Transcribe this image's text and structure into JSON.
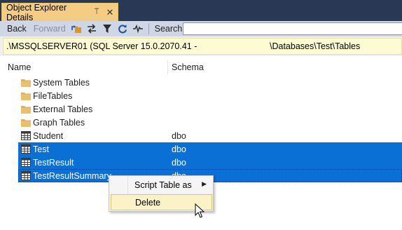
{
  "tab": {
    "title": "Object Explorer Details",
    "pin_glyph": "⍡",
    "close_glyph": "✕"
  },
  "toolbar": {
    "back_label": "Back",
    "forward_label": "Forward",
    "search_label": "Search",
    "search_value": ""
  },
  "pathbar": {
    "server": ".\\MSSQLSERVER01 (SQL Server 15.0.2070.41 -",
    "path": "\\Databases\\Test\\Tables"
  },
  "columns": {
    "name": "Name",
    "schema": "Schema"
  },
  "rows": [
    {
      "name": "System Tables",
      "schema": "",
      "icon": "folder-icon"
    },
    {
      "name": "FileTables",
      "schema": "",
      "icon": "folder-icon"
    },
    {
      "name": "External Tables",
      "schema": "",
      "icon": "folder-icon"
    },
    {
      "name": "Graph Tables",
      "schema": "",
      "icon": "folder-icon"
    },
    {
      "name": "Student",
      "schema": "dbo",
      "icon": "table-icon"
    },
    {
      "name": "Test",
      "schema": "dbo",
      "icon": "table-icon",
      "selected": true
    },
    {
      "name": "TestResult",
      "schema": "dbo",
      "icon": "table-icon",
      "selected": true
    },
    {
      "name": "TestResultSummary",
      "schema": "dbo",
      "icon": "table-icon",
      "selected": true
    }
  ],
  "context_menu": {
    "items": [
      {
        "label": "Script Table as",
        "submenu": true
      },
      {
        "label": "Delete",
        "hover": true
      }
    ]
  },
  "colors": {
    "tab_strip": "#293955",
    "active_tab": "#f5cc84",
    "selection": "#0a70d6",
    "path_bar": "#fdfbd3",
    "menu_hover": "#fcf2c8"
  }
}
